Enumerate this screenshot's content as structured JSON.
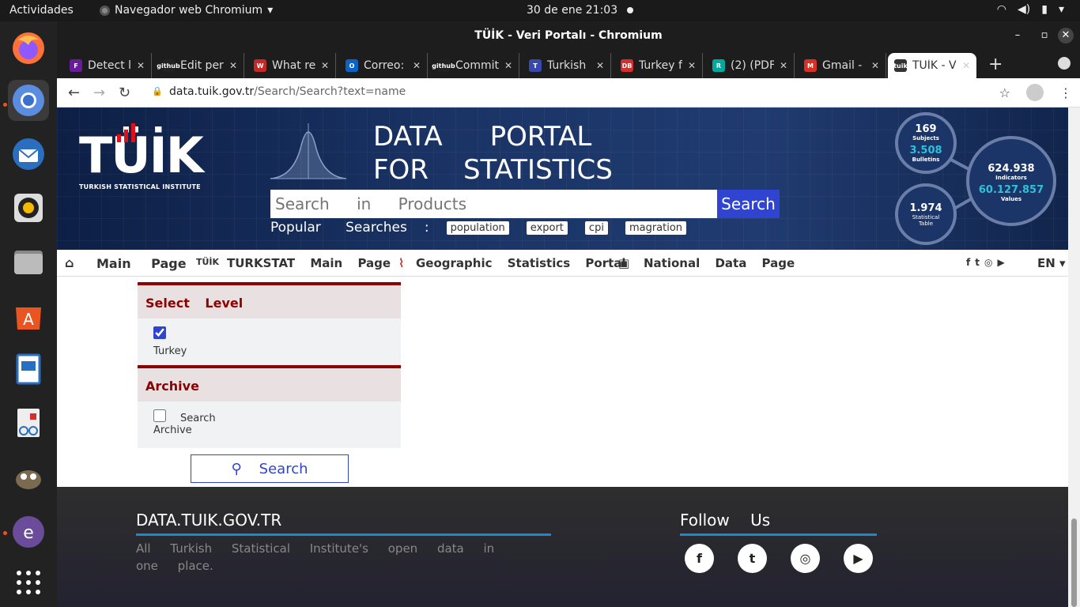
{
  "os": {
    "activities": "Actividades",
    "app_name": "Navegador web Chromium",
    "clock": "30 de ene  21:03"
  },
  "window": {
    "title": "TÜİK - Veri Portalı - Chromium"
  },
  "tabs": [
    {
      "label": "Detect l",
      "icon": "F",
      "color": "#6a1b9a"
    },
    {
      "label": "Edit per",
      "icon": "github",
      "color": "#222222"
    },
    {
      "label": "What re",
      "icon": "W",
      "color": "#c62828"
    },
    {
      "label": "Correo:",
      "icon": "O",
      "color": "#0a64c8"
    },
    {
      "label": "Commit",
      "icon": "github",
      "color": "#222222"
    },
    {
      "label": "Turkish",
      "icon": "T",
      "color": "#3949ab"
    },
    {
      "label": "Turkey f",
      "icon": "DB",
      "color": "#d32f2f"
    },
    {
      "label": "(2) (PDF",
      "icon": "R",
      "color": "#00a99d"
    },
    {
      "label": "Gmail - ",
      "icon": "M",
      "color": "#d93025"
    },
    {
      "label": "TÜİK - V",
      "icon": "tuik",
      "color": "#333333"
    }
  ],
  "address": {
    "domain": "data.tuik.gov.tr",
    "path": "/Search/Search?text=name"
  },
  "hero": {
    "logo_text": "TÜİK",
    "logo_sub": "TURKISH STATISTICAL INSTITUTE",
    "title_line1": [
      "DATA",
      "PORTAL"
    ],
    "title_line2": [
      "FOR",
      "STATISTICS"
    ],
    "search_placeholder": "Search in Products",
    "search_button": "Search",
    "popular_label": "Popular Searches",
    "popular_colon": ":",
    "popular_terms": [
      "population",
      "export",
      "cpi",
      "magration"
    ]
  },
  "stats": {
    "subjects_n": "169",
    "subjects_l": "Subjects",
    "bulletins_n": "3.508",
    "bulletins_l": "Bulletins",
    "tables_n": "1.974",
    "tables_l1": "Statistical",
    "tables_l2": "Table",
    "indicators_n": "624.938",
    "indicators_l": "Indicators",
    "values_n": "60.127.857",
    "values_l": "Values"
  },
  "nav": {
    "main_page": "Main Page",
    "turkstat": "TURKSTAT Main Page",
    "geographic": "Geographic Statistics Portal",
    "national": "National Data Page",
    "lang": "EN"
  },
  "panel": {
    "level_title": "Select Level",
    "level_option": "Turkey",
    "level_checked": true,
    "archive_title": "Archive",
    "archive_option_1": "Search",
    "archive_option_2": "Archive",
    "archive_checked": false,
    "search_button": "Search"
  },
  "footer": {
    "site": "DATA.TUIK.GOV.TR",
    "desc": "All Turkish Statistical Institute's open data in one place.",
    "follow": "Follow Us"
  }
}
